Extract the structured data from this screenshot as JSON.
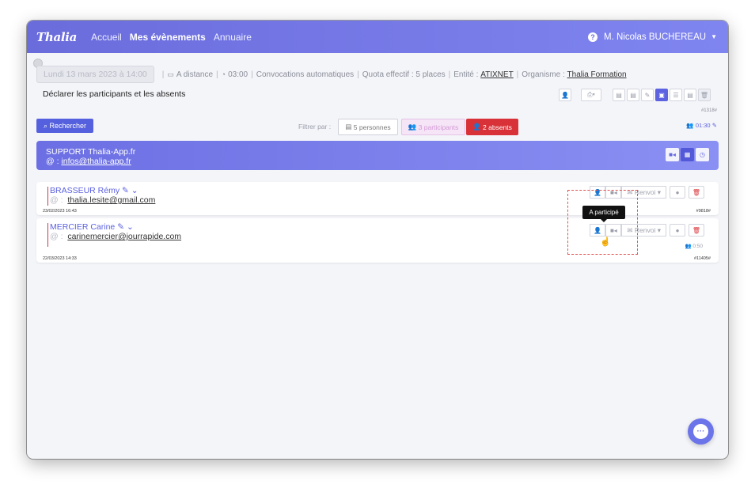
{
  "nav": {
    "brand": "Thalia",
    "links": [
      "Accueil",
      "Mes évènements",
      "Annuaire"
    ],
    "user": "M. Nicolas BUCHEREAU"
  },
  "event": {
    "date": "Lundi 13 mars 2023 à 14:00",
    "mode": "A distance",
    "duration": "03:00",
    "convocations": "Convocations automatiques",
    "quota": "Quota effectif : 5 places",
    "entite_label": "Entité :",
    "entite": "ATIXNET",
    "organisme_label": "Organisme :",
    "organisme": "Thalia Formation",
    "subtitle": "Déclarer les participants et les absents",
    "id": "#1318#"
  },
  "filters": {
    "search": "Rechercher",
    "label": "Filtrer par :",
    "personnes": "5 personnes",
    "participants": "3 participants",
    "absents": "2 absents",
    "time": "01:30"
  },
  "support": {
    "title": "SUPPORT Thalia-App.fr",
    "mail_prefix": "@ :",
    "mail": "infos@thalia-app.fr"
  },
  "participants": [
    {
      "name": "BRASSEUR Rémy",
      "mail_prefix": "@ :",
      "email": "thalia.lesite@gmail.com",
      "date": "23/02/2023 16:43",
      "id": "#9818#",
      "renvoi": "Renvoi",
      "duration": ""
    },
    {
      "name": "MERCIER Carine",
      "mail_prefix": "@ :",
      "email": "carinemercier@jourrapide.com",
      "date": "22/03/2023 14:33",
      "id": "#11405#",
      "renvoi": "Renvoi",
      "duration": "0:50"
    }
  ],
  "tooltip": "A participé",
  "icons": [
    "help-icon",
    "monitor-icon",
    "timer-icon",
    "search-icon",
    "list-icon",
    "user-group-icon",
    "user-minus-icon",
    "edit-icon",
    "chevron-down-icon",
    "user-check-icon",
    "video-icon",
    "mail-icon",
    "comment-icon",
    "trash-icon",
    "calendar-icon",
    "clock-icon",
    "chat-icon",
    "pointer-cursor-icon"
  ],
  "colors": {
    "primary": "#5c62e0",
    "danger": "#d83238",
    "participant_tint": "#f6e4f7"
  }
}
